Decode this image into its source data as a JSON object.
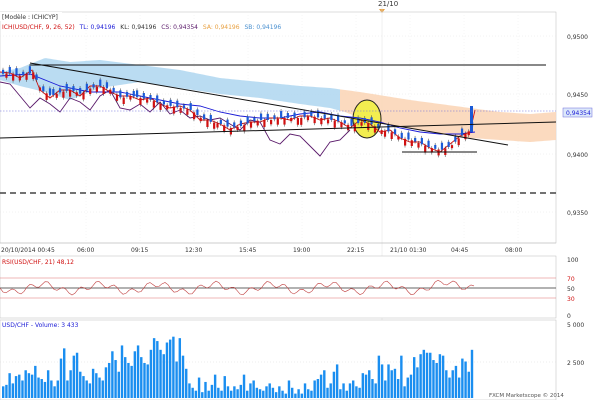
{
  "top_marker": {
    "label": "21/10"
  },
  "window_tag": {
    "label": "[Modèle : ICHICYP]"
  },
  "main_panel": {
    "legend": {
      "instrument": "ICH(USD/CHF, 9, 26, 52)",
      "tl": "TL: 0,94196",
      "kl": "KL: 0,94196",
      "cs": "CS: 0,94354",
      "sa": "SA: 0,94196",
      "sb": "SB: 0,94196"
    },
    "price_labels": [
      "0,9500",
      "0,9450",
      "0,9400",
      "0,9350"
    ],
    "current_price": "0,94354",
    "time_labels": [
      "20/10/2014 00:45",
      "06:00",
      "09:15",
      "12:30",
      "15:45",
      "19:00",
      "22:15",
      "21/10 01:30",
      "04:45",
      "08:00"
    ]
  },
  "rsi_panel": {
    "legend": "RSI(USD/CHF, 21) 48,12",
    "levels": [
      "100",
      "70",
      "50",
      "30",
      "0"
    ]
  },
  "volume_panel": {
    "legend": "USD/CHF - Volume: 3 433",
    "levels": [
      "5 000",
      "2 500"
    ],
    "footer": "FXCM Marketscope © 2014"
  },
  "colors": {
    "kumo": "#aed6f0",
    "kumo_bear": "#fbd6b8",
    "tenkan": "#d01010",
    "kijun": "#1a1ad6",
    "chikou": "#5a1a6a",
    "candle_up": "#1a5ad6",
    "candle_down": "#d01010",
    "volume_bar": "#1a8ef0",
    "highlight": "#f2ee50"
  },
  "chart_data": {
    "type": "candlestick",
    "volume": [
      800,
      900,
      1700,
      1000,
      1500,
      1600,
      1200,
      1900,
      1700,
      1600,
      2200,
      1400,
      1300,
      1100,
      1900,
      1200,
      800,
      1200,
      2700,
      3400,
      1200,
      1900,
      2900,
      3100,
      1800,
      1500,
      1200,
      1000,
      2000,
      1700,
      1400,
      1200,
      2100,
      2400,
      3200,
      2600,
      1800,
      3600,
      2800,
      2400,
      2200,
      3200,
      3600,
      2800,
      2400,
      2300,
      3300,
      4100,
      3900,
      3300,
      3000,
      3800,
      4000,
      4200,
      2500,
      4100,
      2900,
      2000,
      1000,
      700,
      500,
      1400,
      400,
      1100,
      500,
      900,
      1600,
      700,
      500,
      1500,
      800,
      500,
      800,
      600,
      900,
      1600,
      500,
      1000,
      1200,
      700,
      600,
      500,
      800,
      1000,
      700,
      400,
      800,
      500,
      300,
      1200,
      700,
      300,
      600,
      300,
      1000,
      600,
      500,
      1200,
      1300,
      1600,
      1900,
      700,
      1000,
      1800,
      2300,
      600,
      1000,
      500,
      1000,
      1200,
      800,
      700,
      1700,
      1600,
      1900,
      1300,
      1000,
      2900,
      2300,
      1200,
      2300,
      1900,
      2000,
      1300,
      2900,
      800,
      1400,
      1600,
      2800,
      2100,
      3000,
      3300,
      3100,
      3100,
      2600,
      2400,
      3000,
      2900,
      1900,
      1400,
      1900,
      2200,
      1400,
      2700,
      2500,
      1800,
      3300
    ],
    "volume_ylim": [
      0,
      5000
    ],
    "price_ylim": [
      0.931,
      0.953
    ],
    "rsi_ylim": [
      0,
      100
    ]
  }
}
